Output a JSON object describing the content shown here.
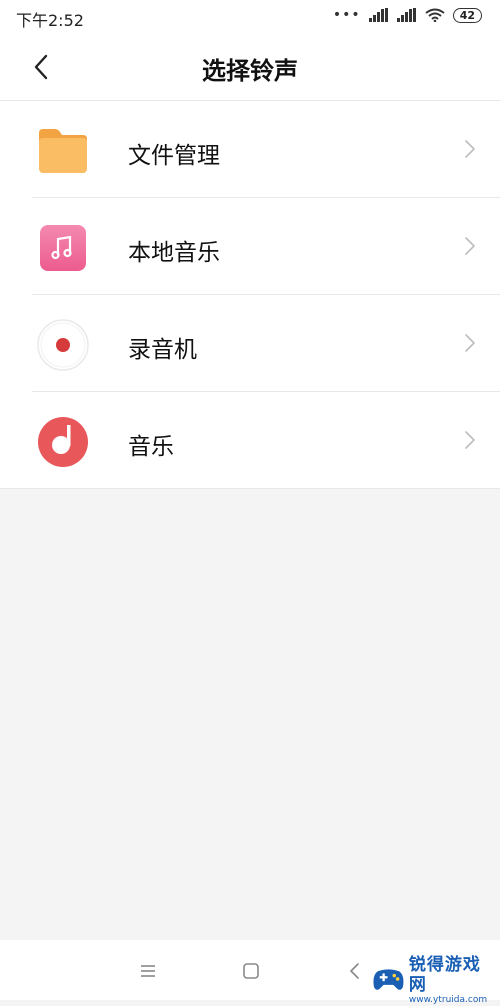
{
  "status_bar": {
    "time": "下午2:52",
    "dots": "•••",
    "battery": "42"
  },
  "header": {
    "title": "选择铃声",
    "back_icon": "chevron-left-icon"
  },
  "items": [
    {
      "label": "文件管理",
      "icon": "folder-icon",
      "color": "#f9b65b"
    },
    {
      "label": "本地音乐",
      "icon": "music-note-icon",
      "color": "#f06292"
    },
    {
      "label": "录音机",
      "icon": "record-icon",
      "color": "#d63b3b"
    },
    {
      "label": "音乐",
      "icon": "music-disc-icon",
      "color": "#e8585b"
    }
  ],
  "nav_bar": {
    "menu_icon": "menu-icon",
    "home_icon": "home-icon",
    "back_icon": "back-icon"
  },
  "watermark": {
    "name": "锐得游戏网",
    "url": "www.ytruida.com"
  }
}
